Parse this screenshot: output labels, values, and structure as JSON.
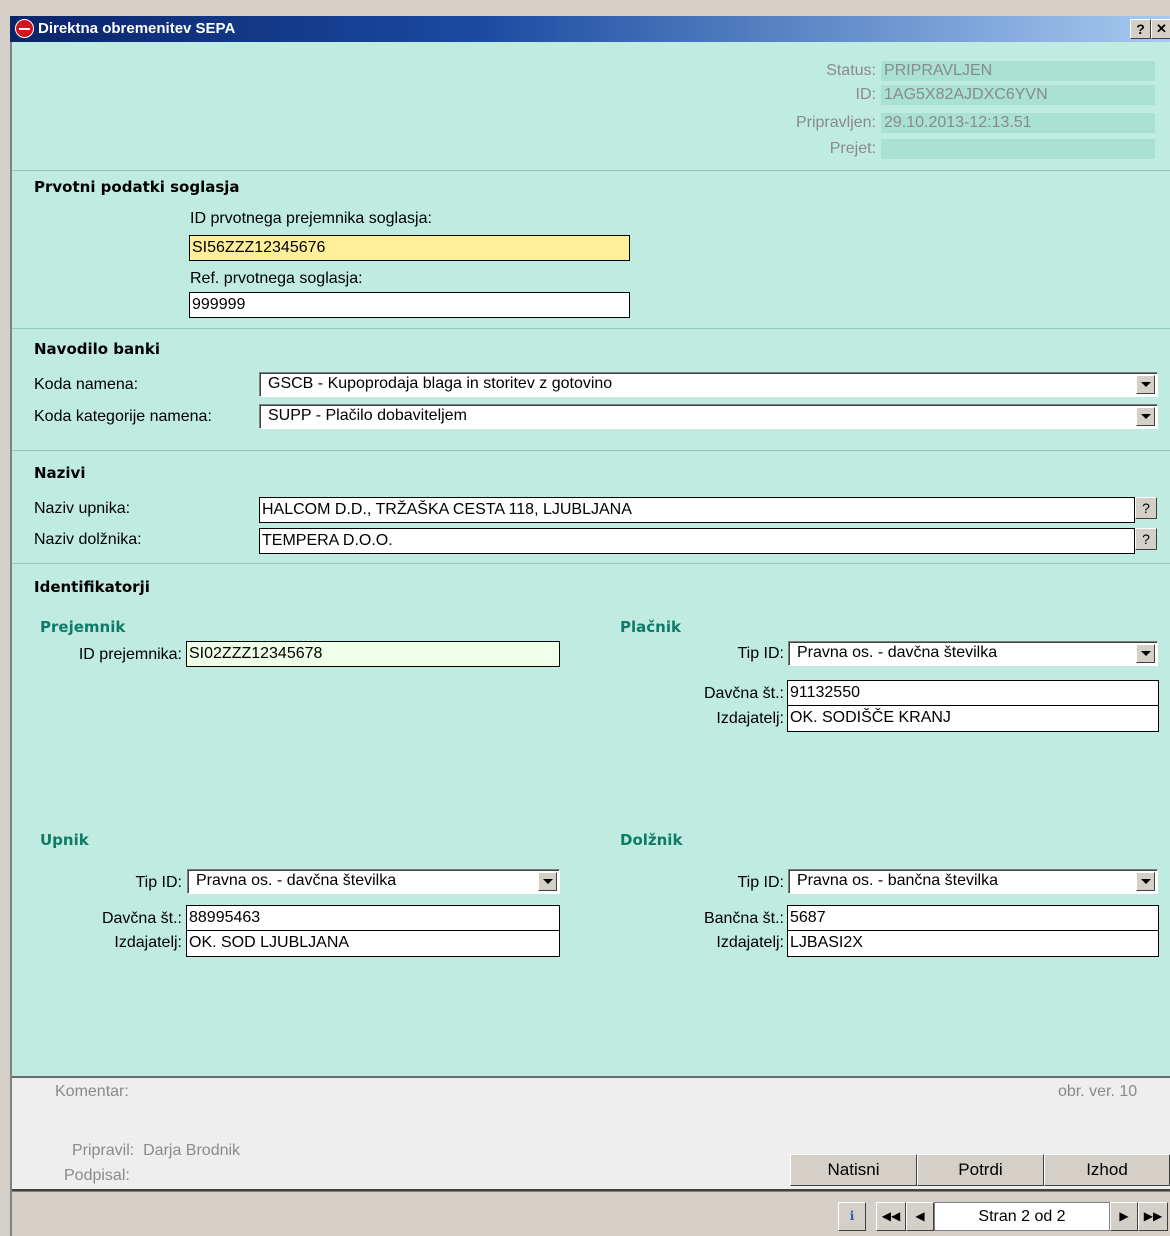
{
  "window": {
    "title": "Direktna obremenitev SEPA",
    "help_btn": "?",
    "close_btn": "✕"
  },
  "status": {
    "status_label": "Status:",
    "status_value": "PRIPRAVLJEN",
    "id_label": "ID:",
    "id_value": "1AG5X82AJDXC6YVN",
    "prepared_label": "Pripravljen:",
    "prepared_value": "29.10.2013-12:13.51",
    "received_label": "Prejet:",
    "received_value": ""
  },
  "original": {
    "heading": "Prvotni podatki soglasja",
    "recipient_id_label": "ID prvotnega prejemnika soglasja:",
    "recipient_id_value": "SI56ZZZ12345676",
    "ref_label": "Ref. prvotnega soglasja:",
    "ref_value": "999999"
  },
  "bank": {
    "heading": "Navodilo banki",
    "purpose_label": "Koda namena:",
    "purpose_value": "GSCB - Kupoprodaja blaga in storitev z gotovino",
    "category_label": "Koda kategorije namena:",
    "category_value": "SUPP - Plačilo dobaviteljem"
  },
  "names": {
    "heading": "Nazivi",
    "creditor_label": "Naziv upnika:",
    "creditor_value": "HALCOM D.D., TRŽAŠKA CESTA 118, LJUBLJANA",
    "debtor_label": "Naziv dolžnika:",
    "debtor_value": "TEMPERA D.O.O.",
    "help": "?"
  },
  "identifiers": {
    "heading": "Identifikatorji",
    "recipient": {
      "heading": "Prejemnik",
      "id_label": "ID prejemnika:",
      "id_value": "SI02ZZZ12345678"
    },
    "payer": {
      "heading": "Plačnik",
      "type_label": "Tip ID:",
      "type_value": "Pravna os. - davčna številka",
      "num_label": "Davčna št.:",
      "num_value": "91132550",
      "issuer_label": "Izdajatelj:",
      "issuer_value": "OK. SODIŠČE KRANJ"
    },
    "creditor": {
      "heading": "Upnik",
      "type_label": "Tip ID:",
      "type_value": "Pravna os. - davčna številka",
      "num_label": "Davčna št.:",
      "num_value": "88995463",
      "issuer_label": "Izdajatelj:",
      "issuer_value": "OK. SOD LJUBLJANA"
    },
    "debtor": {
      "heading": "Dolžnik",
      "type_label": "Tip ID:",
      "type_value": "Pravna os. - bančna številka",
      "num_label": "Bančna št.:",
      "num_value": "5687",
      "issuer_label": "Izdajatelj:",
      "issuer_value": "LJBASI2X"
    }
  },
  "footer": {
    "comment_label": "Komentar:",
    "form_version": "obr. ver. 10",
    "prepared_by": "Pripravil:  Darja Brodnik",
    "signed_label": "Podpisal:",
    "print": "Natisni",
    "confirm": "Potrdi",
    "exit": "Izhod"
  },
  "statusbar": {
    "info_icon": "info-icon",
    "page": "Stran 2 od 2"
  }
}
